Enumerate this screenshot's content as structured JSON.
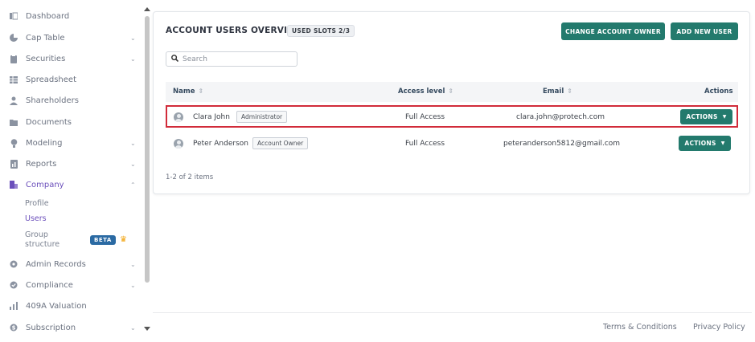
{
  "sidebar": {
    "items": [
      {
        "label": "Dashboard",
        "icon": "dashboard-icon",
        "expandable": false
      },
      {
        "label": "Cap Table",
        "icon": "pie-chart-icon",
        "expandable": true
      },
      {
        "label": "Securities",
        "icon": "clipboard-icon",
        "expandable": true
      },
      {
        "label": "Spreadsheet",
        "icon": "spreadsheet-icon",
        "expandable": false
      },
      {
        "label": "Shareholders",
        "icon": "person-icon",
        "expandable": false
      },
      {
        "label": "Documents",
        "icon": "folder-icon",
        "expandable": false
      },
      {
        "label": "Modeling",
        "icon": "lightbulb-icon",
        "expandable": true
      },
      {
        "label": "Reports",
        "icon": "report-icon",
        "expandable": true
      },
      {
        "label": "Company",
        "icon": "company-icon",
        "expandable": true,
        "active": true
      },
      {
        "label": "Admin Records",
        "icon": "gear-icon",
        "expandable": true
      },
      {
        "label": "Compliance",
        "icon": "shield-check-icon",
        "expandable": true
      },
      {
        "label": "409A Valuation",
        "icon": "valuation-icon",
        "expandable": false
      },
      {
        "label": "Subscription",
        "icon": "dollar-icon",
        "expandable": true
      }
    ],
    "company_sub": {
      "profile": "Profile",
      "users": "Users",
      "group_structure": "Group structure",
      "beta": "BETA"
    }
  },
  "main": {
    "title": "ACCOUNT USERS OVERVIEW",
    "slots_badge": "USED SLOTS 2/3",
    "change_owner_button": "CHANGE ACCOUNT OWNER",
    "add_user_button": "ADD NEW USER",
    "search": {
      "placeholder": "Search",
      "value": ""
    },
    "table": {
      "columns": {
        "name": "Name",
        "access": "Access level",
        "email": "Email",
        "actions": "Actions"
      },
      "rows": [
        {
          "name": "Clara John",
          "role": "Administrator",
          "access": "Full Access",
          "email": "clara.john@protech.com",
          "action": "ACTIONS",
          "selected": true
        },
        {
          "name": "Peter Anderson",
          "role": "Account Owner",
          "access": "Full Access",
          "email": "peteranderson5812@gmail.com",
          "action": "ACTIONS",
          "selected": false
        }
      ]
    },
    "pagination": "1-2 of 2 items"
  },
  "footer": {
    "terms": "Terms & Conditions",
    "privacy": "Privacy Policy"
  },
  "colors": {
    "accent": "#237a6d",
    "active_nav": "#6b4fbb",
    "highlight": "#d12b3a",
    "beta": "#2b6aa3"
  }
}
